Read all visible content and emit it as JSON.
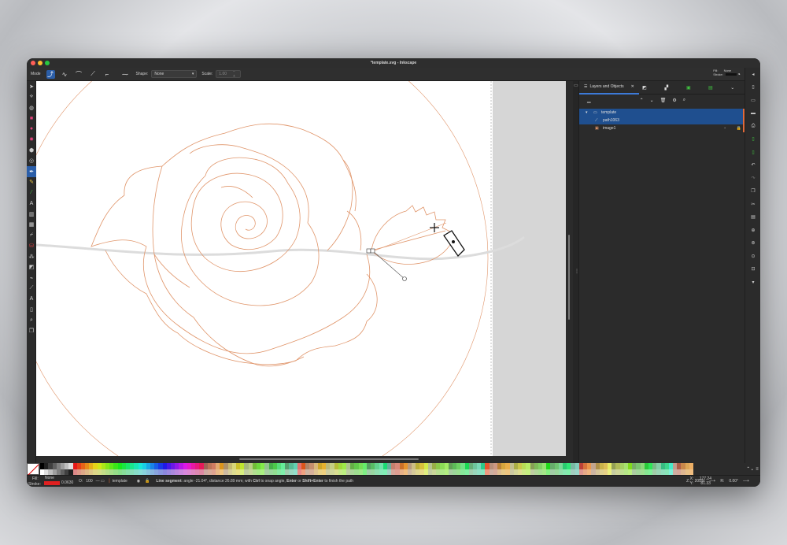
{
  "window": {
    "title": "*template.svg - Inkscape"
  },
  "toolbar": {
    "mode_label": "Mode",
    "shape_label": "Shape:",
    "shape_value": "None",
    "scale_label": "Scale:",
    "scale_value": "1.00",
    "fill_label": "Fill:",
    "fill_value": "None",
    "stroke_label": "Stroke:"
  },
  "panel": {
    "tab_label": "Layers and Objects",
    "layers": [
      {
        "label": "template",
        "type": "layer",
        "selected": true
      },
      {
        "label": "path1063",
        "type": "path",
        "selected": true
      },
      {
        "label": "image1",
        "type": "image",
        "selected": false
      }
    ]
  },
  "status": {
    "fill_label": "Fill:",
    "fill_value": "None",
    "stroke_label": "Stroke:",
    "stroke_width": "0.0630",
    "opacity_label": "O:",
    "opacity_value": "100",
    "layer_name": "template",
    "message_bold": "Line segment",
    "message": ": angle -21.04°, distance 26.89 mm; with ",
    "key_ctrl": "Ctrl",
    "message2": " to snap angle, ",
    "key_enter": "Enter",
    "message3": " or ",
    "key_shift_enter": "Shift+Enter",
    "message4": " to finish the path",
    "x_label": "X:",
    "x_value": "177.24",
    "y_label": "Y:",
    "y_value": "81.33",
    "zoom_label": "Z:",
    "zoom_value": "205%",
    "rotation_label": "R:",
    "rotation_value": "0.00°"
  },
  "colors": {
    "accent": "#2b5ea8",
    "path_stroke": "#e0956a",
    "stroke_swatch": "#e02020"
  }
}
